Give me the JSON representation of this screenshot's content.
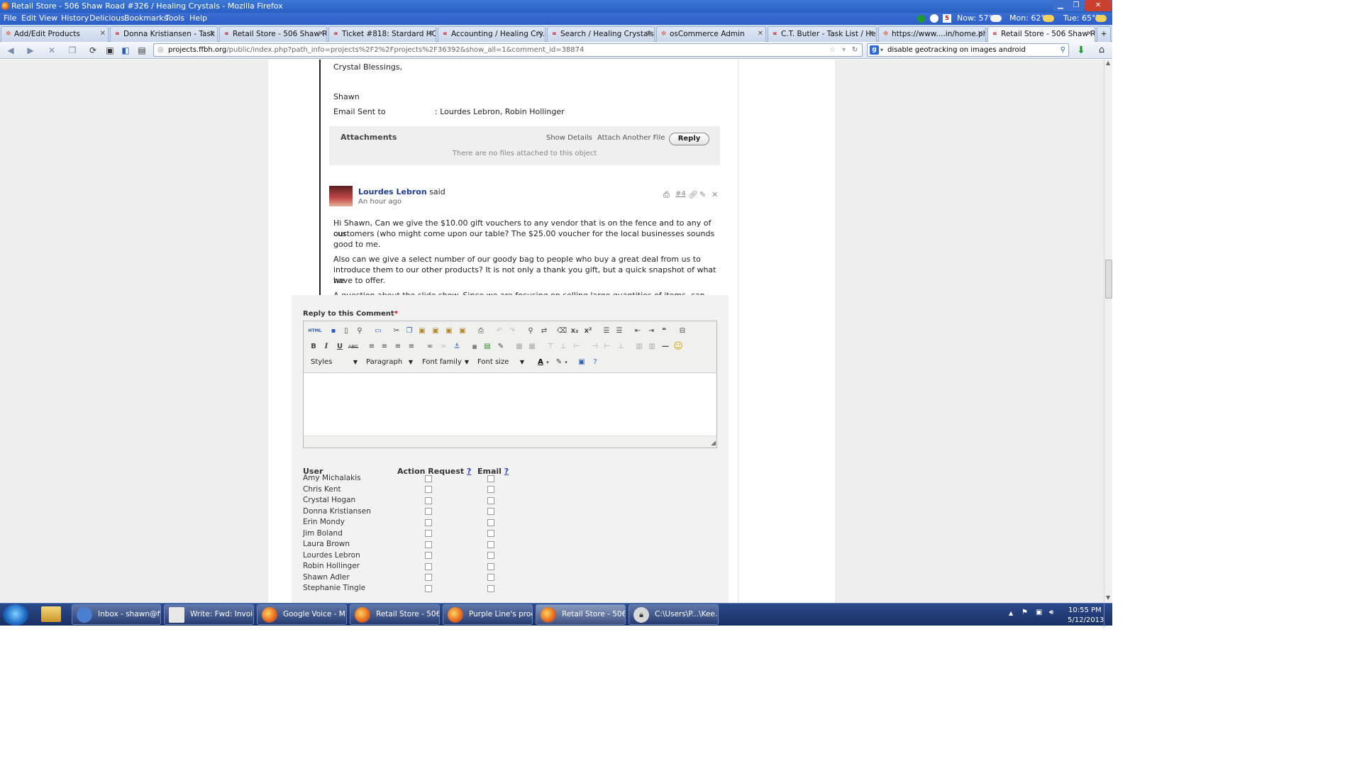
{
  "window": {
    "title": "Retail Store - 506 Shaw Road #326 / Healing Crystals - Mozilla Firefox"
  },
  "menu": [
    "File",
    "Edit",
    "View",
    "History",
    "Delicious",
    "Bookmarks",
    "Tools",
    "Help"
  ],
  "weather": {
    "now": "Now: 57°F",
    "mon": "Mon: 62°F",
    "tue": "Tue: 65°F",
    "calendar_day": "5"
  },
  "tabs": [
    {
      "label": "Add/Edit Products",
      "icon": "osc"
    },
    {
      "label": "Donna Kristiansen - Task ...",
      "icon": "ac"
    },
    {
      "label": "Retail Store - 506 Shaw Ro...",
      "icon": "ac"
    },
    {
      "label": "Ticket #818: Stardard HC i...",
      "icon": "ac"
    },
    {
      "label": "Accounting / Healing Cry...",
      "icon": "ac"
    },
    {
      "label": "Search / Healing Crystals",
      "icon": "search"
    },
    {
      "label": "osCommerce Admin",
      "icon": "osc"
    },
    {
      "label": "C.T. Butler - Task List / He...",
      "icon": "ac"
    },
    {
      "label": "https://www....in/home.php",
      "icon": "osc"
    },
    {
      "label": "Retail Store - 506 Shaw Ro...",
      "icon": "ac"
    }
  ],
  "nav": {
    "url_host": "projects.ffbh.org",
    "url_path": "/public/index.php?path_info=projects%2F2%2Fprojects%2F36392&show_all=1&comment_id=38874",
    "search_text": "disable geotracking on images android"
  },
  "previous_comment": {
    "signoff": "Crystal Blessings,",
    "name": "Shawn",
    "email_label": "Email Sent to",
    "email_value": ": Lourdes Lebron, Robin Hollinger"
  },
  "attachments": {
    "title": "Attachments",
    "show_details": "Show Details",
    "attach_another": "Attach Another File",
    "reply": "Reply",
    "empty_text": "There are no files attached to this object"
  },
  "comment": {
    "author": "Lourdes Lebron",
    "said": "said",
    "time": "An hour ago",
    "number": "#4",
    "p1_l1": "Hi Shawn, Can we give the $10.00 gift vouchers to any vendor that is on the fence and to any of our",
    "p1_l2": "customers (who might come upon our table? The $25.00 voucher for the local businesses sounds",
    "p1_l3": "good to me.",
    "p2_l1": "Also can we give a select number of our goody bag to people who buy a great deal from us to",
    "p2_l2": "introduce them to our other products? It is not only a thank you gift, but a quick snapshot of what we",
    "p2_l3": "have to offer.",
    "p3_l1": "A question about the slide show. Since we are focusing on selling large quantities of items, can we"
  },
  "reply_form": {
    "label": "Reply to this Comment",
    "required_mark": "*",
    "dropdowns": {
      "styles": "Styles",
      "format": "Paragraph",
      "font_family": "Font family",
      "font_size": "Font size"
    },
    "toolbar_text": {
      "html": "HTML",
      "bold": "B",
      "italic": "I",
      "underline": "U",
      "strike": "ABC"
    },
    "columns": {
      "user": "User",
      "action": "Action Request",
      "email": "Email",
      "help": "?"
    },
    "users": [
      "Amy Michalakis",
      "Chris Kent",
      "Crystal Hogan",
      "Donna Kristiansen",
      "Erin Mondy",
      "Jim Boland",
      "Laura Brown",
      "Lourdes Lebron",
      "Robin Hollinger",
      "Shawn Adler",
      "Stephanie Tingle"
    ]
  },
  "taskbar": {
    "items": [
      {
        "label": "Inbox - shawn@ff...",
        "icon": "thunderbird"
      },
      {
        "label": "Write: Fwd: Invoic...",
        "icon": "write"
      },
      {
        "label": "Google Voice - M...",
        "icon": "firefox"
      },
      {
        "label": "Retail Store - 506 ...",
        "icon": "firefox"
      },
      {
        "label": "Purple Line's prog...",
        "icon": "firefox"
      },
      {
        "label": "Retail Store - 506 ...",
        "icon": "firefox"
      },
      {
        "label": "C:\\Users\\P...\\Kee...",
        "icon": "keepass"
      }
    ],
    "time": "10:55 PM",
    "date": "5/12/2013"
  }
}
